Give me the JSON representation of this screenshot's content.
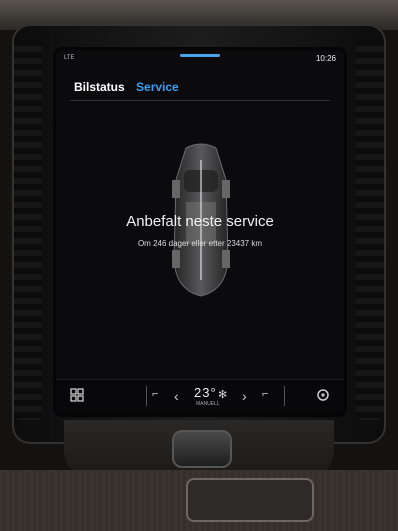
{
  "statusbar": {
    "left": "LTE",
    "right": "10:26"
  },
  "tabs": [
    {
      "label": "Bilstatus"
    },
    {
      "label": "Service"
    }
  ],
  "service": {
    "title": "Anbefalt neste service",
    "subtitle": "Om 246 dager eller etter 23437 km"
  },
  "bottombar": {
    "temperature": "23°",
    "mode": "MANUELL"
  },
  "icons": {
    "grid": "grid-icon",
    "seat_left": "seat-heat-icon",
    "arrow_left": "chevron-left-icon",
    "fan": "fan-icon",
    "arrow_right": "chevron-right-icon",
    "seat_right": "seat-icon",
    "settings": "fan-settings-icon"
  },
  "colors": {
    "accent": "#3a9ff0",
    "screen_bg": "#0b0b0d"
  }
}
